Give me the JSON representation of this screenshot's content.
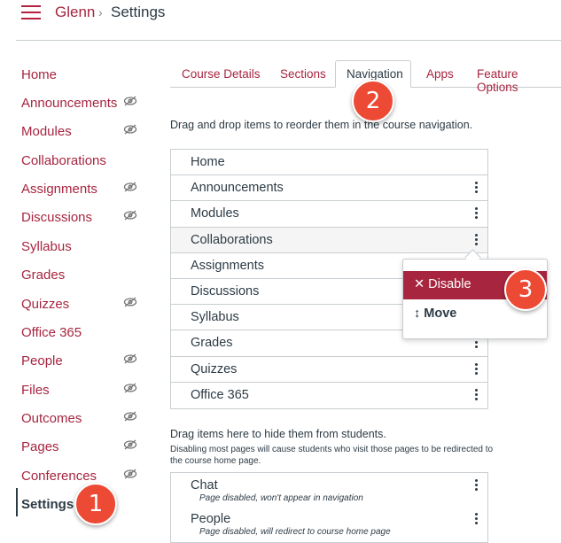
{
  "header": {
    "course": "Glenn",
    "separator": "›",
    "current": "Settings"
  },
  "sidebar": {
    "items": [
      {
        "label": "Home",
        "hidden": false
      },
      {
        "label": "Announcements",
        "hidden": true
      },
      {
        "label": "Modules",
        "hidden": true
      },
      {
        "label": "Collaborations",
        "hidden": false
      },
      {
        "label": "Assignments",
        "hidden": true
      },
      {
        "label": "Discussions",
        "hidden": true
      },
      {
        "label": "Syllabus",
        "hidden": false
      },
      {
        "label": "Grades",
        "hidden": false
      },
      {
        "label": "Quizzes",
        "hidden": true
      },
      {
        "label": "Office 365",
        "hidden": false
      },
      {
        "label": "People",
        "hidden": true
      },
      {
        "label": "Files",
        "hidden": true
      },
      {
        "label": "Outcomes",
        "hidden": true
      },
      {
        "label": "Pages",
        "hidden": true
      },
      {
        "label": "Conferences",
        "hidden": true
      },
      {
        "label": "Settings",
        "hidden": false
      }
    ]
  },
  "tabs": [
    "Course Details",
    "Sections",
    "Navigation",
    "Apps",
    "Feature Options"
  ],
  "instructions": "Drag and drop items to reorder them in the course navigation.",
  "nav_items": [
    "Home",
    "Announcements",
    "Modules",
    "Collaborations",
    "Assignments",
    "Discussions",
    "Syllabus",
    "Grades",
    "Quizzes",
    "Office 365"
  ],
  "menu": {
    "disable": "✕ Disable",
    "move": "↕ Move"
  },
  "hidden_section": {
    "title": "Drag items here to hide them from students.",
    "note": "Disabling most pages will cause students who visit those pages to be redirected to the course home page.",
    "items": [
      {
        "label": "Chat",
        "sub": "Page disabled, won't appear in navigation"
      },
      {
        "label": "People",
        "sub": "Page disabled, will redirect to course home page"
      }
    ]
  },
  "callouts": [
    "2",
    "3",
    "1"
  ],
  "colors": {
    "brand": "#a7253f",
    "callout": "#ec4a34",
    "text": "#2d3b45"
  }
}
